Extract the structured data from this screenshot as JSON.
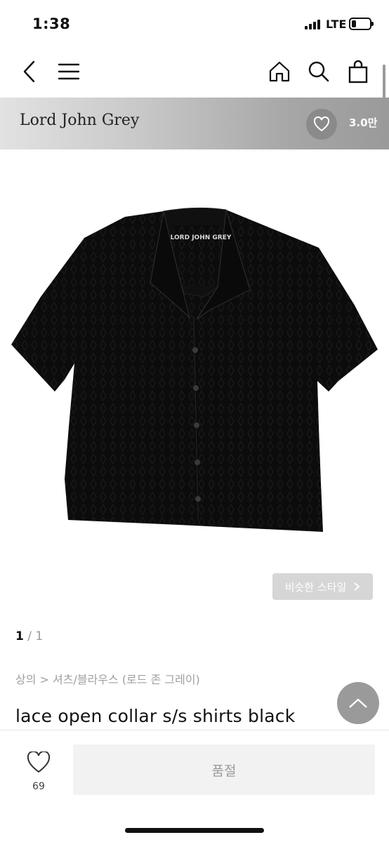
{
  "status_bar": {
    "time": "1:38",
    "network": "LTE",
    "battery_level": 0.25
  },
  "nav": {
    "back_icon": "chevron-left-icon",
    "menu_icon": "hamburger-menu-icon",
    "home_icon": "home-icon",
    "search_icon": "search-icon",
    "cart_icon": "shopping-bag-icon"
  },
  "brand": {
    "name": "Lord John Grey",
    "like_count": "3.0만",
    "like_icon": "heart-icon"
  },
  "product": {
    "image_label": "LORD JOHN GREY",
    "similar_style_label": "비슷한 스타일",
    "pager_current": "1",
    "pager_separator": "/",
    "pager_total": "1",
    "breadcrumb": "상의 > 셔츠/블라우스 (로드 존 그레이)",
    "title": "lace open collar s/s shirts black"
  },
  "bottom_bar": {
    "like_count": "69",
    "soldout_label": "품절"
  },
  "colors": {
    "banner_dark": "#9a9a9a",
    "shirt": "#0d0d0d",
    "muted_text": "#a0a0a0"
  }
}
